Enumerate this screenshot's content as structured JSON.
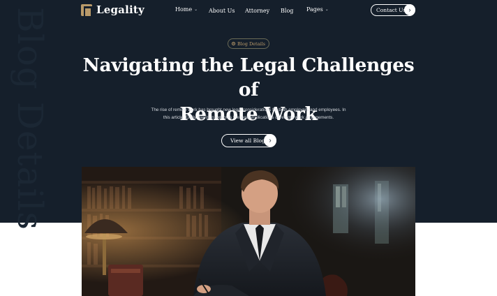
{
  "brand": {
    "name": "Legality",
    "logo_icon": "scales-logo-icon"
  },
  "nav": {
    "items": [
      {
        "label": "Home",
        "has_dropdown": true
      },
      {
        "label": "About Us",
        "has_dropdown": false
      },
      {
        "label": "Attorney",
        "has_dropdown": false
      },
      {
        "label": "Blog",
        "has_dropdown": false
      },
      {
        "label": "Pages",
        "has_dropdown": true
      }
    ],
    "contact_label": "Contact Us"
  },
  "hero": {
    "watermark": "Blog Details",
    "badge": "Blog Details",
    "title_line1": "Navigating the Legal Challenges of",
    "title_line2": "Remote Work",
    "description": "The rise of remote work has brought new legal considerations for both employers and employees. In this article, Emily Harrison explores the legal implications of remote work arrangements.",
    "cta_label": "View all Blog"
  },
  "colors": {
    "background": "#151f2b",
    "accent": "#b99a6a",
    "text": "#ffffff"
  }
}
